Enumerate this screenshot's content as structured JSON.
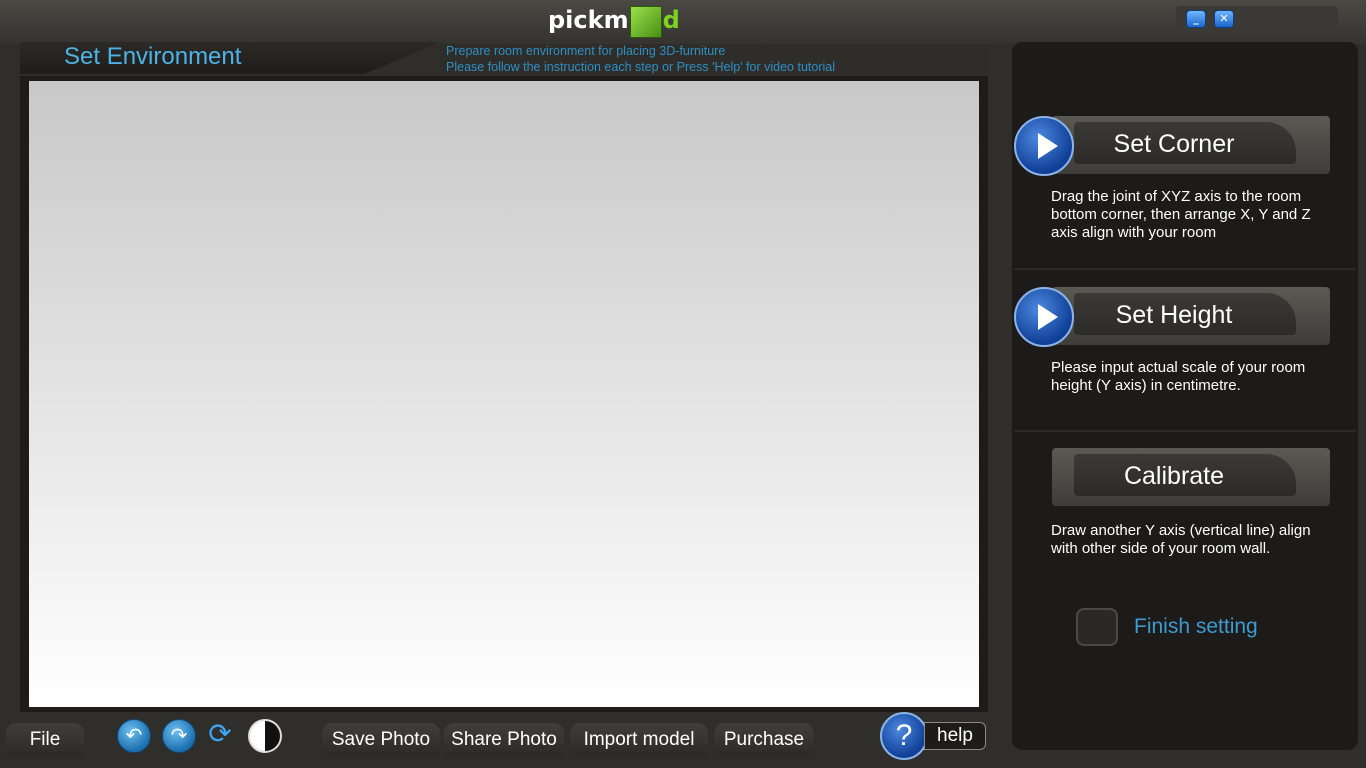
{
  "app": {
    "logo_text": "pickm",
    "logo_suffix": "d"
  },
  "window_controls": {
    "minimize_label": "_",
    "close_label": "✕"
  },
  "header": {
    "title": "Set Environment",
    "instruction_line1": "Prepare room environment for placing 3D-furniture",
    "instruction_line2": "Please follow the instruction each step or Press   'Help'   for video tutorial"
  },
  "steps": [
    {
      "label": "Set Corner",
      "description": "Drag the joint of XYZ axis to the room bottom corner, then arrange X, Y and Z axis align with your room",
      "has_play_icon": true
    },
    {
      "label": "Set Height",
      "description": "Please input actual scale of your room height (Y axis) in centimetre.",
      "has_play_icon": true
    },
    {
      "label": "Calibrate",
      "description": "Draw another Y axis (vertical line) align with other side of your room wall.",
      "has_play_icon": false
    }
  ],
  "finish": {
    "label": "Finish setting",
    "checked": false
  },
  "toolbar": {
    "file_label": "File",
    "save_photo_label": "Save Photo",
    "share_photo_label": "Share Photo",
    "import_model_label": "Import model",
    "purchase_label": "Purchase",
    "help_label": "help",
    "help_icon_label": "?",
    "undo_icon_label": "↶",
    "redo_icon_label": "↷",
    "refresh_icon_label": "⟳"
  },
  "icons": {
    "undo": "undo-icon",
    "redo": "redo-icon",
    "refresh": "refresh-icon",
    "contrast": "contrast-icon",
    "play": "play-icon",
    "help": "question-icon"
  },
  "colors": {
    "accent_blue": "#4db3e6",
    "instruction_blue": "#2f8fc4",
    "logo_green": "#7ed321",
    "finish_blue": "#3e9bd0"
  }
}
